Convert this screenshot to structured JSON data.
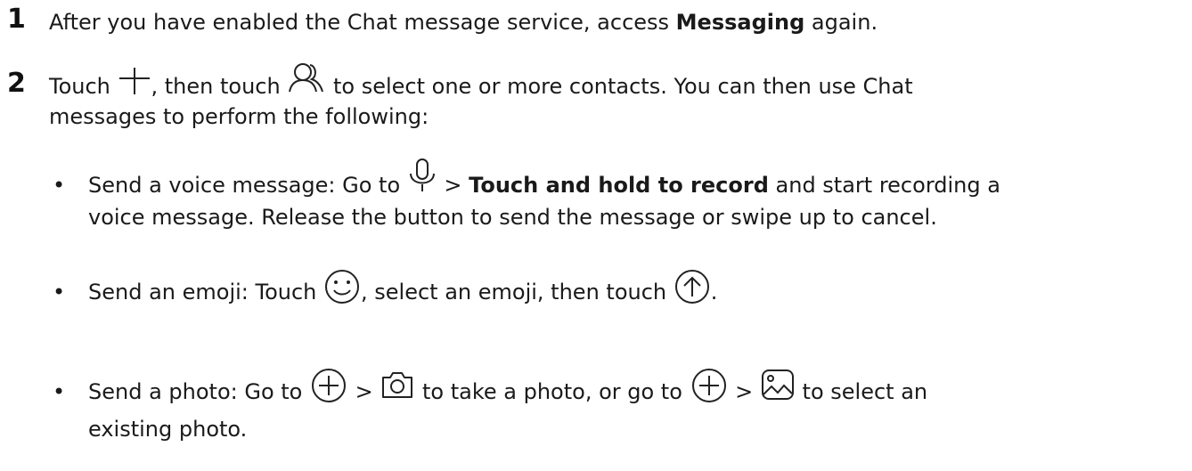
{
  "steps": [
    {
      "number": "1",
      "prefix": "After you have enabled the Chat message service, access ",
      "bold": "Messaging",
      "suffix": " again."
    },
    {
      "number": "2",
      "line1_a": "Touch ",
      "line1_b": ", then touch ",
      "line1_c": " to select one or more contacts. You can then use Chat",
      "line2": "messages to perform the following:"
    }
  ],
  "bullets": {
    "marker": "•",
    "voice": {
      "a": "Send a voice message: Go to ",
      "b": " > ",
      "bold": "Touch and hold to record",
      "c": " and start recording a",
      "line2": "voice message. Release the button to send the message or swipe up to cancel."
    },
    "emoji": {
      "a": "Send an emoji: Touch ",
      "b": ", select an emoji, then touch ",
      "c": "."
    },
    "photo": {
      "a": "Send a photo: Go to ",
      "b": " > ",
      "c": " to take a photo, or go to ",
      "d": " > ",
      "e": " to select an",
      "line2": "existing photo."
    }
  },
  "icons": [
    "plus-icon",
    "contacts-icon",
    "microphone-icon",
    "smiley-icon",
    "send-up-icon",
    "add-circle-icon",
    "camera-icon",
    "add-circle-icon",
    "gallery-icon"
  ]
}
